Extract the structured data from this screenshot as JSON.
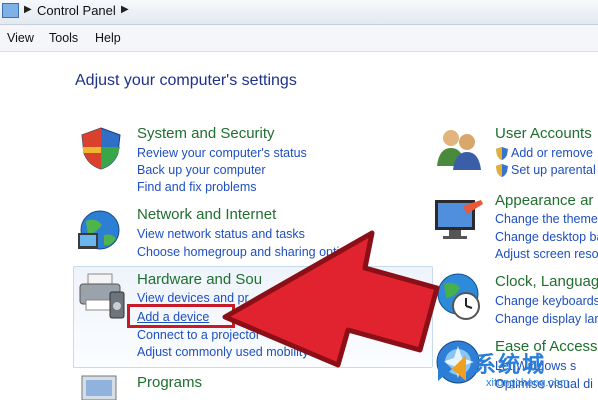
{
  "address_bar": {
    "breadcrumb": "Control Panel"
  },
  "menu": {
    "items": [
      "View",
      "Tools",
      "Help"
    ]
  },
  "page": {
    "heading": "Adjust your computer's settings"
  },
  "categories": {
    "system": {
      "title": "System and Security",
      "links": [
        "Review your computer's status",
        "Back up your computer",
        "Find and fix problems"
      ]
    },
    "network": {
      "title": "Network and Internet",
      "links": [
        "View network status and tasks",
        "Choose homegroup and sharing opti"
      ]
    },
    "hardware": {
      "title": "Hardware and Sou",
      "links": [
        "View devices and pr",
        "Add a device",
        "Connect to a projector",
        "Adjust commonly used mobility"
      ]
    },
    "programs": {
      "title": "Programs"
    },
    "user_accounts": {
      "title": "User Accounts",
      "links": [
        "Add or remove",
        "Set up parental"
      ]
    },
    "appearance": {
      "title": "Appearance ar",
      "links": [
        "Change the theme",
        "Change desktop ba",
        "Adjust screen resol"
      ]
    },
    "clock": {
      "title": "Clock, Languag",
      "links": [
        "Change keyboards",
        "Change display lan"
      ]
    },
    "ease": {
      "title": "Ease of Access",
      "links": [
        "Let Windows s",
        "Optimise visual di"
      ]
    }
  },
  "watermark": {
    "text": "系统城",
    "url": "xitongcheng.com"
  },
  "colors": {
    "arrow": "#e0232f",
    "highlight": "#c81b2a",
    "link": "#1f4fbf",
    "title": "#1f6f2f"
  }
}
